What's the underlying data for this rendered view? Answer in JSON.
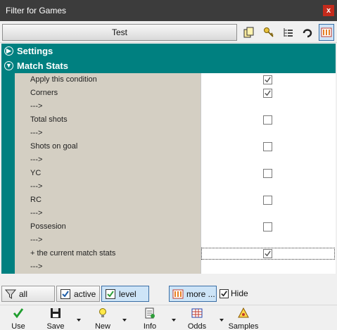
{
  "window": {
    "title": "Filter for Games",
    "close_glyph": "x"
  },
  "top_toolbar": {
    "name": "Test",
    "icons": [
      "copy-icon",
      "key-icon",
      "tree-list-icon",
      "hook-icon",
      "columns-icon"
    ]
  },
  "groups": [
    {
      "label": "Settings",
      "expanded": false
    },
    {
      "label": "Match Stats",
      "expanded": true
    }
  ],
  "rows": [
    {
      "label": "Apply this condition",
      "checkbox": true,
      "checked": true
    },
    {
      "label": "Corners",
      "checkbox": true,
      "checked": true
    },
    {
      "label": "--->",
      "checkbox": false
    },
    {
      "label": "Total shots",
      "checkbox": true,
      "checked": false
    },
    {
      "label": "--->",
      "checkbox": false
    },
    {
      "label": "Shots on goal",
      "checkbox": true,
      "checked": false
    },
    {
      "label": "--->",
      "checkbox": false
    },
    {
      "label": "YC",
      "checkbox": true,
      "checked": false
    },
    {
      "label": "--->",
      "checkbox": false
    },
    {
      "label": "RC",
      "checkbox": true,
      "checked": false
    },
    {
      "label": "--->",
      "checkbox": false
    },
    {
      "label": "Possesion",
      "checkbox": true,
      "checked": false
    },
    {
      "label": "--->",
      "checkbox": false
    },
    {
      "label": "+ the current match stats",
      "checkbox": true,
      "checked": true,
      "focused": true
    },
    {
      "label": "--->",
      "checkbox": false
    }
  ],
  "filter_bar": {
    "all_label": "all",
    "active_label": "active",
    "level_label": "level",
    "more_label": "more ...",
    "hide_label": "Hide"
  },
  "bottom_bar": {
    "use_label": "Use",
    "save_label": "Save",
    "new_label": "New",
    "info_label": "Info",
    "odds_label": "Odds",
    "samples_label": "Samples"
  },
  "colors": {
    "accent": "#008080",
    "label_bg": "#d4cfc3",
    "titlebar": "#3c3c3c"
  }
}
